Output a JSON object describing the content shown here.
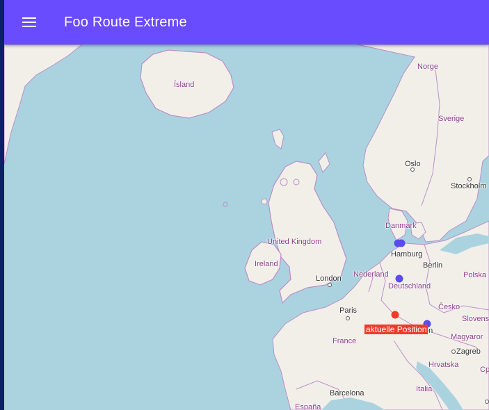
{
  "app": {
    "title": "Foo Route Extreme",
    "menu_icon": "menu-icon"
  },
  "colors": {
    "appbar": "#6a4cff",
    "sea": "#aad3df",
    "land": "#f2efe9",
    "border": "#b98fc8",
    "waypoint": "#5b4cf0",
    "current_position": "#ef3b2c"
  },
  "map": {
    "labels": {
      "island": "Ísland",
      "norway": "Norge",
      "sweden": "Sverige",
      "oslo": "Oslo",
      "stockholm": "Stockholm",
      "denmark": "Danmark",
      "uk": "United Kingdom",
      "ireland": "Ireland",
      "hamburg": "Hamburg",
      "berlin": "Berlin",
      "netherlands": "Nederland",
      "london": "London",
      "germany": "Deutschland",
      "poland": "Polska",
      "czech": "Česko",
      "slovakia": "Slovens",
      "paris": "Paris",
      "france": "France",
      "vienna_partial": "en",
      "hungary": "Magyaror",
      "zagreb": "Zagreb",
      "croatia": "Hrvatska",
      "italy": "Italia",
      "barcelona": "Barcelona",
      "spain": "España",
      "cyprus_partial": "Cp"
    },
    "current_position_label": "aktuelle Position"
  }
}
